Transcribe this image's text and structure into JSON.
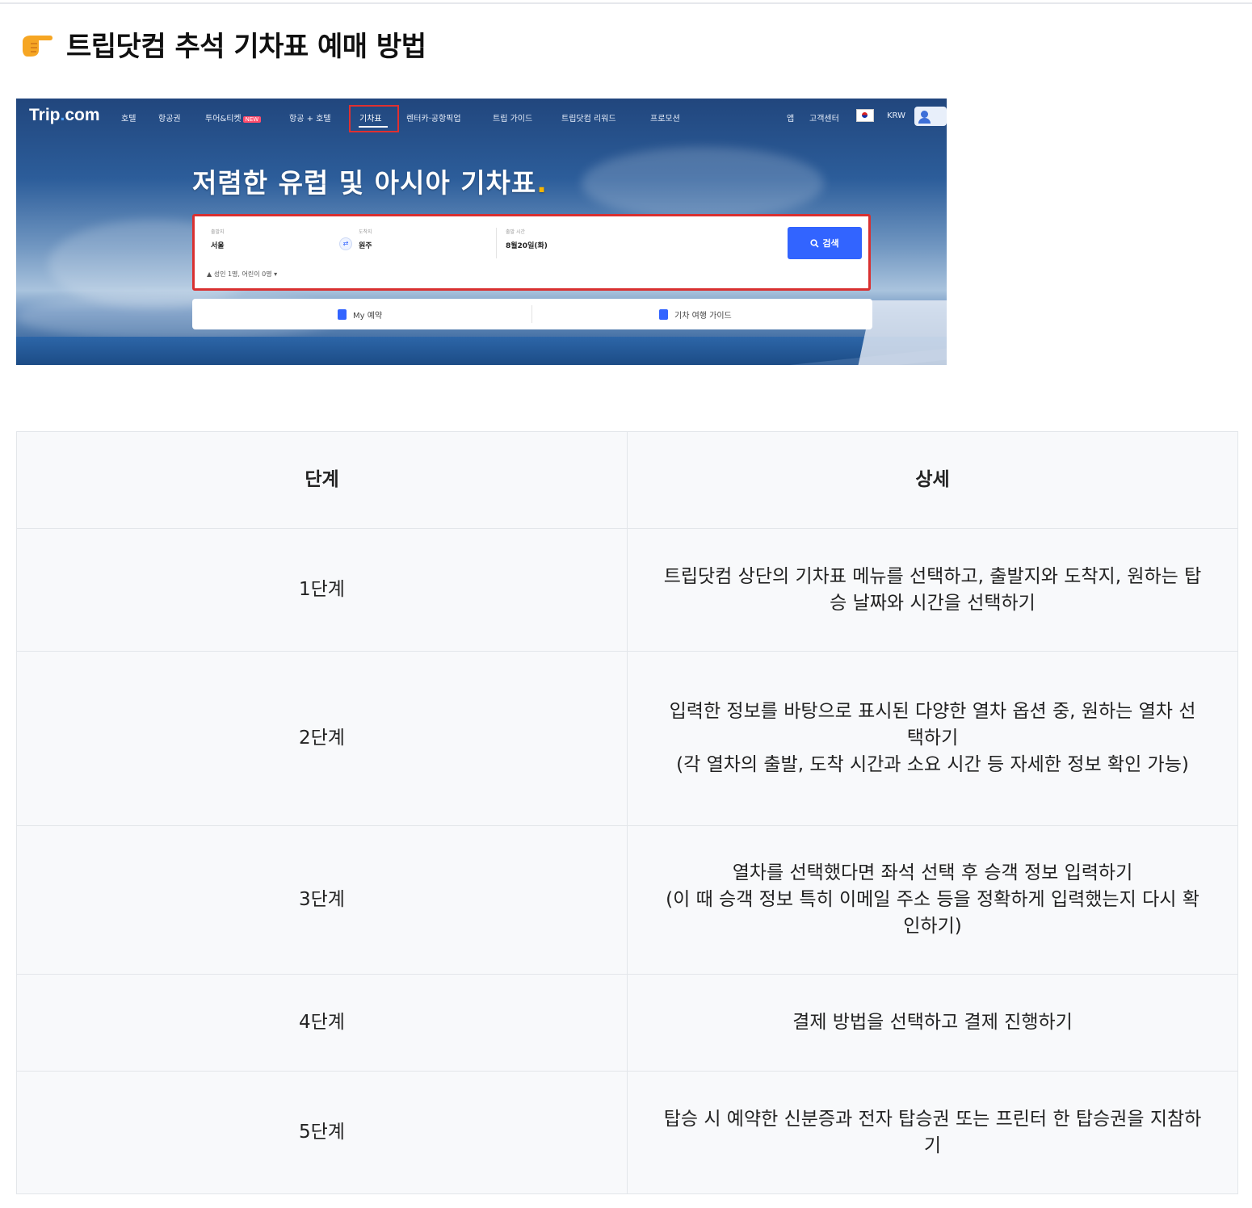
{
  "heading": {
    "icon": "pointing-hand-icon",
    "title": "트립닷컴 추석 기차표 예매 방법"
  },
  "screenshot": {
    "logo": "Trip.com",
    "nav": [
      "호텔",
      "항공권",
      "투어&티켓",
      "항공 + 호텔",
      "기차표",
      "렌터카·공항픽업",
      "트립 가이드",
      "트립닷컴 리워드",
      "프로모션"
    ],
    "nav_badge": "NEW",
    "nav_right": [
      "앱",
      "고객센터",
      "KRW"
    ],
    "hero_title": "저렴한 유럽 및 아시아 기차표",
    "hero_title_dot": ".",
    "search": {
      "from_label": "출발지",
      "from_value": "서울",
      "to_label": "도착지",
      "to_value": "원주",
      "date_label": "출발 시간",
      "date_value": "8월20일(화)",
      "button": "검색",
      "passengers": "성인 1명, 어린이 0명"
    },
    "bottom": {
      "my_booking": "My 예약",
      "guide": "기차 여행 가이드"
    }
  },
  "table": {
    "headers": [
      "단계",
      "상세"
    ],
    "rows": [
      {
        "step": "1단계",
        "detail": [
          "트립닷컴 상단의 기차표 메뉴를 선택하고, 출발지와 도착지, 원하는 탑승 날짜와 시간을 선택하기"
        ]
      },
      {
        "step": "2단계",
        "detail": [
          "입력한 정보를 바탕으로 표시된 다양한 열차 옵션 중, 원하는 열차 선택하기",
          "(각 열차의 출발, 도착 시간과 소요 시간 등 자세한 정보 확인 가능)"
        ]
      },
      {
        "step": "3단계",
        "detail": [
          "열차를 선택했다면 좌석 선택 후 승객 정보 입력하기",
          "(이 때 승객 정보 특히 이메일 주소 등을 정확하게 입력했는지 다시 확인하기)"
        ]
      },
      {
        "step": "4단계",
        "detail": [
          "결제 방법을 선택하고 결제 진행하기"
        ]
      },
      {
        "step": "5단계",
        "detail": [
          "탑승 시 예약한 신분증과 전자 탑승권 또는 프린터 한 탑승권을 지참하기"
        ]
      }
    ]
  }
}
